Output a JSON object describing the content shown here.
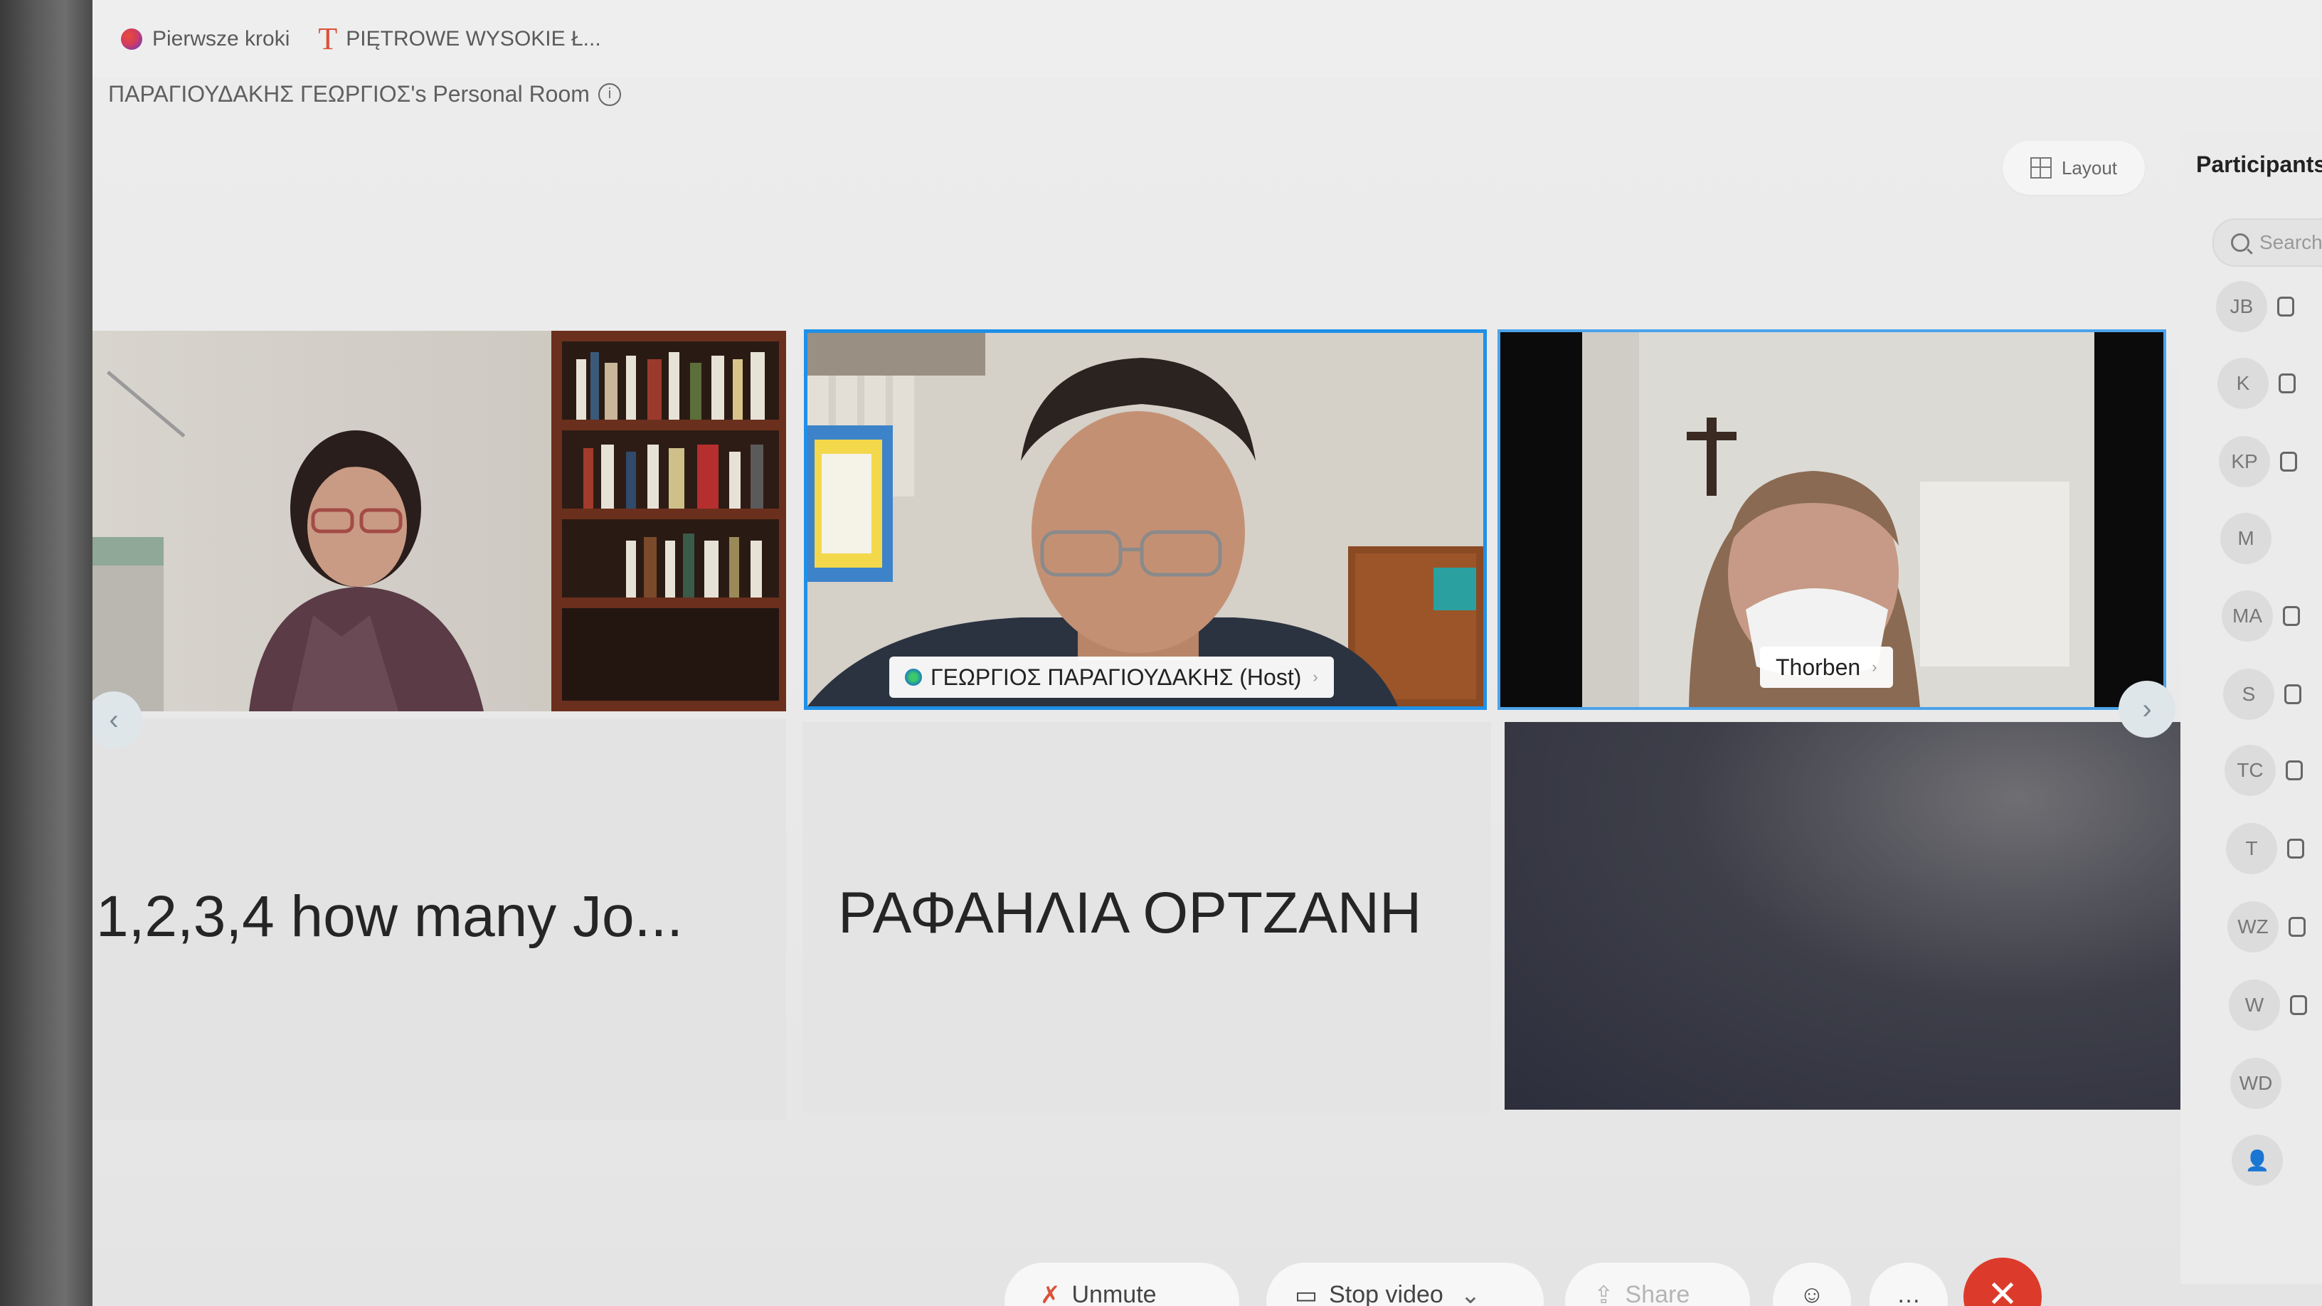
{
  "bookmarks": [
    {
      "label": "Pierwsze kroki",
      "icon": "globe-icon"
    },
    {
      "label": "PIĘTROWE WYSOKIE Ł...",
      "icon": "t-logo-icon"
    }
  ],
  "room": {
    "title": "ΠΑΡΑΓΙΟΥΔΑΚΗΣ ΓΕΩΡΓΙΟΣ's Personal Room",
    "info_icon": "ⓘ"
  },
  "toolbar": {
    "layout_label": "Layout"
  },
  "participants": {
    "title": "Participants",
    "search_placeholder": "Search",
    "items": [
      {
        "initials": "JB"
      },
      {
        "initials": "K"
      },
      {
        "initials": "KP"
      },
      {
        "initials": "M"
      },
      {
        "initials": "MA"
      },
      {
        "initials": "S"
      },
      {
        "initials": "TC"
      },
      {
        "initials": "T"
      },
      {
        "initials": "WZ"
      },
      {
        "initials": "W"
      },
      {
        "initials": "WD"
      },
      {
        "initials": "👤"
      }
    ]
  },
  "video": {
    "tiles": [
      {
        "label": "",
        "kind": "video"
      },
      {
        "label": "ΓΕΩΡΓΙΟΣ ΠΑΡΑΓΙΟΥΔΑΚΗΣ (Host)",
        "kind": "video",
        "active": true
      },
      {
        "label": "Thorben",
        "kind": "video"
      },
      {
        "name": "1,2,3,4 how many Jo...",
        "kind": "name"
      },
      {
        "name": "ΡΑΦΑΗΛΙΑ ΟΡΤΖΑΝΗ",
        "kind": "name"
      },
      {
        "name": "",
        "kind": "blank"
      }
    ],
    "prev_arrow": "‹",
    "next_arrow": "›"
  },
  "controls": {
    "mute_label": "Unmute",
    "video_label": "Stop video",
    "share_label": "Share",
    "leave_icon": "✕"
  },
  "colors": {
    "accent": "#1f90e8",
    "leave": "#dc3b2b"
  }
}
